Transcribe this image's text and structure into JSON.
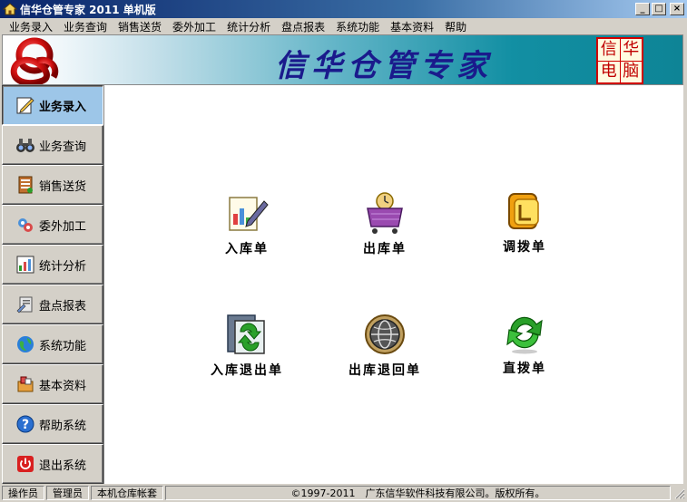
{
  "window": {
    "title": "信华仓管专家 2011 单机版",
    "min_glyph": "_",
    "max_glyph": "□",
    "close_glyph": "×"
  },
  "menu": [
    "业务录入",
    "业务查询",
    "销售送货",
    "委外加工",
    "统计分析",
    "盘点报表",
    "系统功能",
    "基本资料",
    "帮助"
  ],
  "banner": {
    "title": "信华仓管专家",
    "stamp": [
      "信",
      "华",
      "电",
      "脑"
    ]
  },
  "sidebar": {
    "items": [
      {
        "label": "业务录入",
        "icon": "edit-icon"
      },
      {
        "label": "业务查询",
        "icon": "binoculars-icon"
      },
      {
        "label": "销售送货",
        "icon": "delivery-icon"
      },
      {
        "label": "委外加工",
        "icon": "processing-icon"
      },
      {
        "label": "统计分析",
        "icon": "analysis-icon"
      },
      {
        "label": "盘点报表",
        "icon": "report-icon"
      },
      {
        "label": "系统功能",
        "icon": "globe-icon"
      },
      {
        "label": "基本资料",
        "icon": "data-icon"
      },
      {
        "label": "帮助系统",
        "icon": "help-icon"
      },
      {
        "label": "退出系统",
        "icon": "power-icon"
      }
    ],
    "active_index": 0
  },
  "actions": [
    {
      "label": "入库单",
      "icon": "stock-in-icon"
    },
    {
      "label": "出库单",
      "icon": "cart-icon"
    },
    {
      "label": "调拨单",
      "icon": "transfer-icon"
    },
    {
      "label": "入库退出单",
      "icon": "stock-return-icon"
    },
    {
      "label": "出库退回单",
      "icon": "globe-return-icon"
    },
    {
      "label": "直拨单",
      "icon": "direct-transfer-icon"
    }
  ],
  "status": {
    "role_label": "操作员",
    "role_value": "管理员",
    "account": "本机仓库帐套",
    "copyright": "©1997-2011　广东信华软件科技有限公司。版权所有。"
  },
  "colors": {
    "title_bar": "#0a246a",
    "banner_title": "#1a1a8c",
    "stamp": "#d00000",
    "active_nav": "#9dc6e8"
  }
}
